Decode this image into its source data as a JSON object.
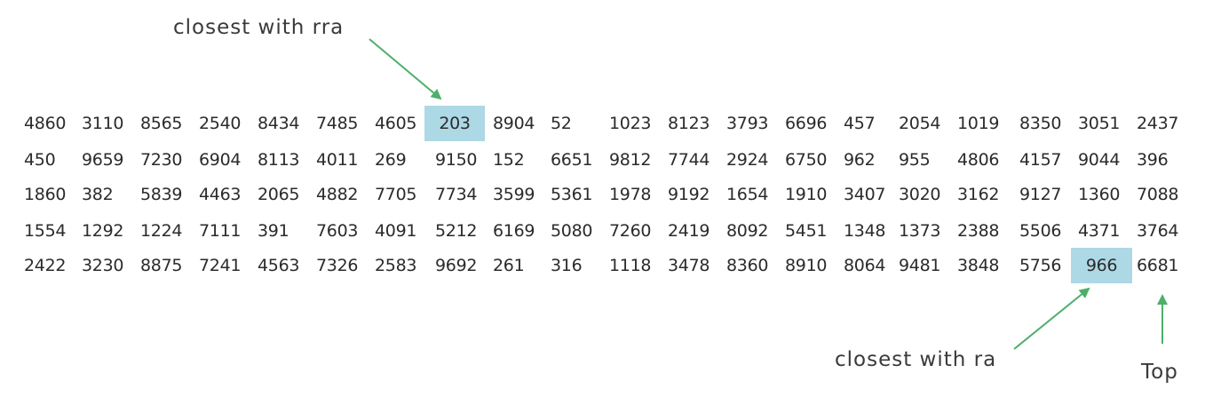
{
  "grid": {
    "rows": [
      [
        "4860",
        "3110",
        "8565",
        "2540",
        "8434",
        "7485",
        "4605",
        "203",
        "8904",
        "52",
        "1023",
        "8123",
        "3793",
        "6696",
        "457",
        "2054",
        "1019",
        "8350",
        "3051",
        "2437"
      ],
      [
        "450",
        "9659",
        "7230",
        "6904",
        "8113",
        "4011",
        "269",
        "9150",
        "152",
        "6651",
        "9812",
        "7744",
        "2924",
        "6750",
        "962",
        "955",
        "4806",
        "4157",
        "9044",
        "396"
      ],
      [
        "1860",
        "382",
        "5839",
        "4463",
        "2065",
        "4882",
        "7705",
        "7734",
        "3599",
        "5361",
        "1978",
        "9192",
        "1654",
        "1910",
        "3407",
        "3020",
        "3162",
        "9127",
        "1360",
        "7088"
      ],
      [
        "1554",
        "1292",
        "1224",
        "7111",
        "391",
        "7603",
        "4091",
        "5212",
        "6169",
        "5080",
        "7260",
        "2419",
        "8092",
        "5451",
        "1348",
        "1373",
        "2388",
        "5506",
        "4371",
        "3764"
      ],
      [
        "2422",
        "3230",
        "8875",
        "7241",
        "4563",
        "7326",
        "2583",
        "9692",
        "261",
        "316",
        "1118",
        "3478",
        "8360",
        "8910",
        "8064",
        "9481",
        "3848",
        "5756",
        "966",
        "6681"
      ]
    ],
    "highlights": [
      {
        "row": 0,
        "col": 7
      },
      {
        "row": 4,
        "col": 18
      }
    ],
    "highlight_color": "#add8e6",
    "text_color": "#2b2b2b"
  },
  "annotations": {
    "rra_label": "closest with rra",
    "ra_label": "closest with ra",
    "top_label": "Top",
    "arrow_color": "#4caf6a"
  }
}
